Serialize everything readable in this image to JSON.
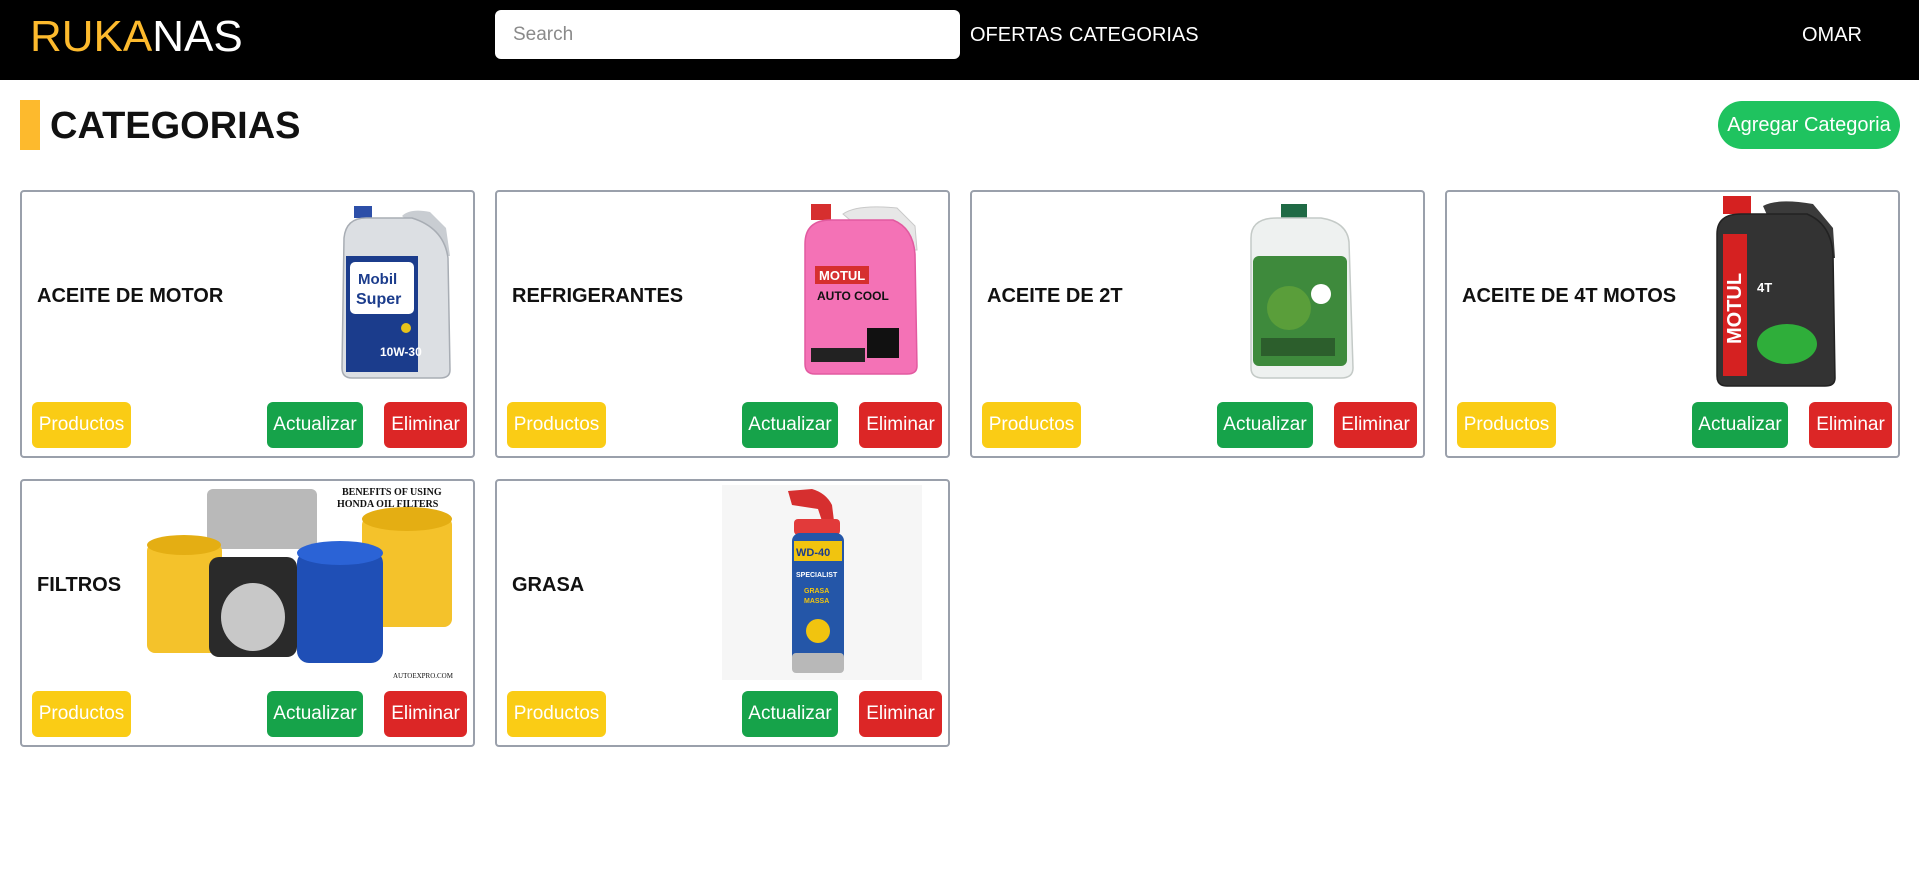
{
  "brand": {
    "part1": "RUKA",
    "part2": "NAS"
  },
  "search": {
    "placeholder": "Search",
    "value": ""
  },
  "nav": {
    "ofertas": "OFERTAS",
    "categorias": "CATEGORIAS",
    "user": "OMAR"
  },
  "page": {
    "title": "CATEGORIAS",
    "add_button": "Agregar Categoria"
  },
  "colors": {
    "accent": "#FDBA2D",
    "add": "#1FC35F",
    "productos": "#FACC15",
    "actualizar": "#16A34A",
    "eliminar": "#DC2626"
  },
  "card_buttons": {
    "productos": "Productos",
    "actualizar": "Actualizar",
    "eliminar": "Eliminar"
  },
  "categories": [
    {
      "name": "ACEITE DE MOTOR",
      "image": "motor-oil-jug-image"
    },
    {
      "name": "REFRIGERANTES",
      "image": "coolant-jug-image"
    },
    {
      "name": "ACEITE DE 2T",
      "image": "2t-oil-jug-image"
    },
    {
      "name": "ACEITE DE 4T MOTOS",
      "image": "4t-oil-jug-image"
    },
    {
      "name": "FILTROS",
      "image": "oil-filters-image"
    },
    {
      "name": "GRASA",
      "image": "grease-spray-can-image"
    }
  ],
  "images": {
    "mobil": {
      "line1": "Mobil",
      "line2": "Super",
      "grade": "10W-30"
    },
    "motul_cool": {
      "brand": "MOTUL",
      "line": "AUTO COOL"
    },
    "motul_4t": {
      "brand": "MOTUL",
      "line": "4T"
    },
    "filters_caption": {
      "line1": "BENEFITS OF USING",
      "line2": "HONDA OIL FILTERS",
      "footer": "AUTOEXPRO.COM"
    },
    "wd40": {
      "brand": "WD-40",
      "line1": "SPECIALIST",
      "line2": "GRASA",
      "line3": "MASSA"
    }
  }
}
